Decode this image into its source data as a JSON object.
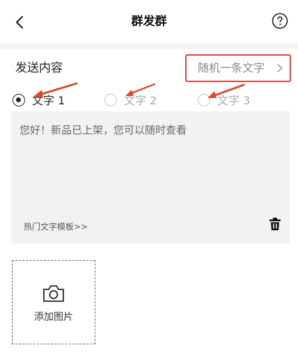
{
  "header": {
    "title": "群发群"
  },
  "send": {
    "label": "发送内容",
    "random_label": "随机一条文字"
  },
  "options": [
    {
      "label": "文字 1",
      "selected": true
    },
    {
      "label": "文字 2",
      "selected": false
    },
    {
      "label": "文字 3",
      "selected": false
    }
  ],
  "content": {
    "text": "您好！新品已上架，您可以随时查看",
    "template_link": "热门文字模板>>"
  },
  "upload": {
    "label": "添加图片"
  },
  "colors": {
    "highlight_box": "#d9443b",
    "annotation_arrow": "#e04a2a",
    "text_area_bg": "#f2f2f2"
  }
}
